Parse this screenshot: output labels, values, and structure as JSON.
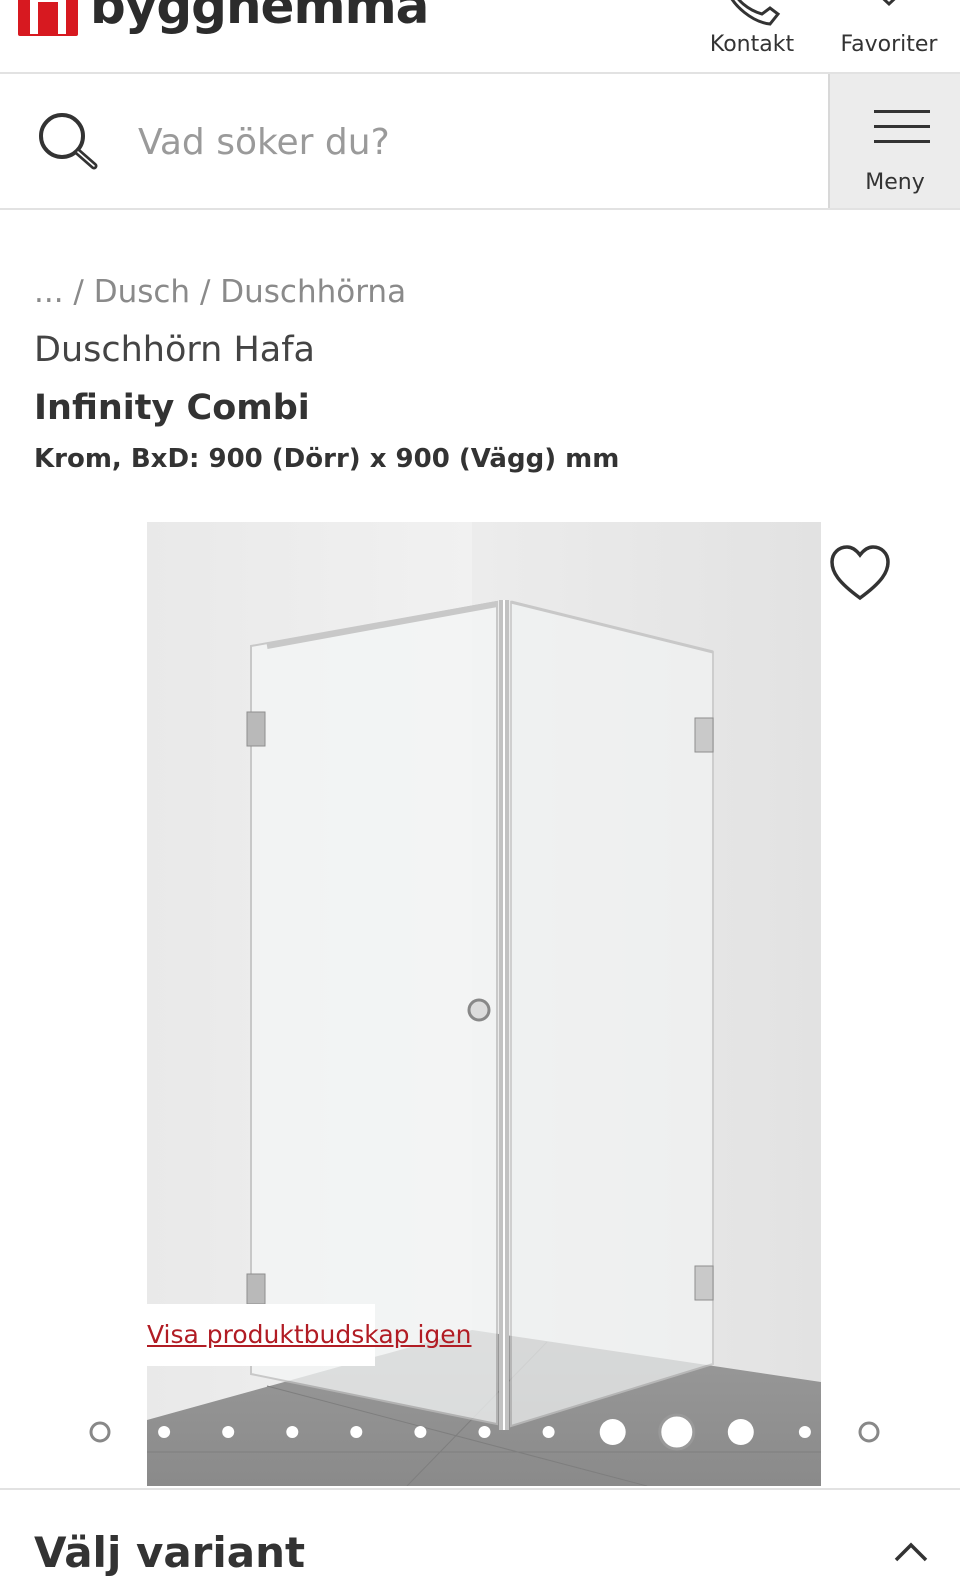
{
  "header": {
    "brand": "byggnemma",
    "contact_label": "Kontakt",
    "favorites_label": "Favoriter"
  },
  "search": {
    "placeholder": "Vad söker du?",
    "value": "",
    "menu_label": "Meny"
  },
  "breadcrumb": {
    "items": [
      "...",
      "Dusch",
      "Duschhörna"
    ],
    "separator": " / "
  },
  "product": {
    "brand_line": "Duschhörn Hafa",
    "title": "Infinity Combi",
    "subtitle": "Krom, BxD: 900 (Dörr) x 900 (Vägg) mm"
  },
  "gallery": {
    "show_message_link": "Visa produktbudskap igen",
    "total_images": 13,
    "active_index": 9
  },
  "variant": {
    "title": "Välj variant"
  },
  "colors": {
    "brand_red": "#d71920",
    "link_red": "#b11c24",
    "text": "#333333",
    "muted": "#8a8a8a"
  },
  "icons": {
    "contact": "phone-icon",
    "favorites": "heart-icon",
    "search": "search-icon",
    "menu": "hamburger-icon",
    "wishlist": "heart-outline-icon",
    "expand": "chevron-up-icon"
  }
}
